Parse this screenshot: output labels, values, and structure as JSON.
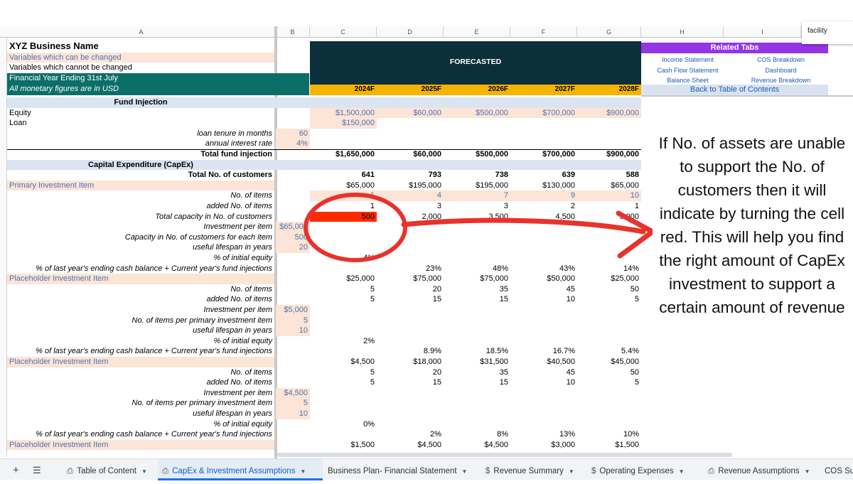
{
  "window": {
    "filter_box": "facility"
  },
  "col_headers": [
    "A",
    "B",
    "C",
    "D",
    "E",
    "F",
    "G",
    "H",
    "I"
  ],
  "header": {
    "business_name": "XYZ Business Name",
    "var_changed": "Variables which can be changed",
    "var_not_changed": "Variables which cannot be changed",
    "fy": "Financial Year Ending 31st July",
    "currency": "All monetary figures are in USD",
    "forecasted": "FORECASTED",
    "years": [
      "2024F",
      "2025F",
      "2026F",
      "2027F",
      "2028F"
    ]
  },
  "related_tabs": {
    "title": "Related Tabs",
    "links": [
      "Income Statement",
      "COS Breakdown",
      "Cash Flow Statement",
      "Dashboard",
      "Balance Sheet",
      "Revenue Breakdown"
    ],
    "back": "Back to Table of Contents"
  },
  "rows": [
    {
      "a": "Fund Injection",
      "type": "section"
    },
    {
      "a": "Equity",
      "al": "l",
      "c": [
        "$1,500,000",
        "$60,000",
        "$500,000",
        "$700,000",
        "$900,000"
      ],
      "cstyle": "input"
    },
    {
      "a": "Loan",
      "al": "l",
      "c": [
        "$150,000",
        "",
        "",
        "",
        ""
      ],
      "cstyle": "input1"
    },
    {
      "a": "loan tenure in months",
      "it": true,
      "b": "60"
    },
    {
      "a": "annual interest rate",
      "it": true,
      "b": "4%"
    },
    {
      "a": "Total fund injection",
      "bold": true,
      "c": [
        "$1,650,000",
        "$60,000",
        "$500,000",
        "$700,000",
        "$900,000"
      ],
      "border": true
    },
    {
      "a": "Capital Expenditure (CapEx)",
      "type": "section"
    },
    {
      "a": "Total No. of customers",
      "bold": true,
      "c": [
        "641",
        "793",
        "738",
        "639",
        "588"
      ]
    },
    {
      "a": "Primary Investment Item",
      "type": "item",
      "c": [
        "$65,000",
        "$195,000",
        "$195,000",
        "$130,000",
        "$65,000"
      ]
    },
    {
      "a": "No. of items",
      "it": true,
      "c": [
        "1",
        "4",
        "7",
        "9",
        "10"
      ],
      "cstyle": "input"
    },
    {
      "a": "added No. of items",
      "it": true,
      "c": [
        "1",
        "3",
        "3",
        "2",
        "1"
      ]
    },
    {
      "a": "Total capacity in No. of customers",
      "it": true,
      "c": [
        "500",
        "2,000",
        "3,500",
        "4,500",
        "5,000"
      ],
      "red": true
    },
    {
      "a": "Investment per item",
      "it": true,
      "b": "$65,000"
    },
    {
      "a": "Capacity in No. of customers for each item",
      "it": true,
      "b": "500"
    },
    {
      "a": "useful lifespan in years",
      "it": true,
      "b": "20"
    },
    {
      "a": "% of initial equity",
      "it": true,
      "c": [
        "4%",
        "",
        "",
        "",
        ""
      ]
    },
    {
      "a": "% of last year's ending cash balance + Current year's fund injections",
      "it": true,
      "c": [
        "",
        "23%",
        "48%",
        "43%",
        "14%"
      ]
    },
    {
      "a": "Placeholder Investment Item",
      "type": "item",
      "c": [
        "$25,000",
        "$75,000",
        "$75,000",
        "$50,000",
        "$25,000"
      ]
    },
    {
      "a": "No. of items",
      "it": true,
      "c": [
        "5",
        "20",
        "35",
        "45",
        "50"
      ]
    },
    {
      "a": "added No. of items",
      "it": true,
      "c": [
        "5",
        "15",
        "15",
        "10",
        "5"
      ]
    },
    {
      "a": "Investment per item",
      "it": true,
      "b": "$5,000"
    },
    {
      "a": "No. of items per primary investment item",
      "it": true,
      "b": "5"
    },
    {
      "a": "useful lifespan in years",
      "it": true,
      "b": "10"
    },
    {
      "a": "% of initial equity",
      "it": true,
      "c": [
        "2%",
        "",
        "",
        "",
        ""
      ]
    },
    {
      "a": "% of last year's ending cash balance + Current year's fund injections",
      "it": true,
      "c": [
        "",
        "8.9%",
        "18.5%",
        "16.7%",
        "5.4%"
      ]
    },
    {
      "a": "Placeholder Investment Item",
      "type": "item",
      "c": [
        "$4,500",
        "$18,000",
        "$31,500",
        "$40,500",
        "$45,000"
      ]
    },
    {
      "a": "No. of items",
      "it": true,
      "c": [
        "5",
        "20",
        "35",
        "45",
        "50"
      ]
    },
    {
      "a": "added No. of items",
      "it": true,
      "c": [
        "5",
        "15",
        "15",
        "10",
        "5"
      ]
    },
    {
      "a": "Investment per item",
      "it": true,
      "b": "$4,500"
    },
    {
      "a": "No. of items per primary investment item",
      "it": true,
      "b": "5"
    },
    {
      "a": "useful lifespan in years",
      "it": true,
      "b": "10"
    },
    {
      "a": "% of initial equity",
      "it": true,
      "c": [
        "0%",
        "",
        "",
        "",
        ""
      ]
    },
    {
      "a": "% of last year's ending cash balance + Current year's fund injections",
      "it": true,
      "c": [
        "",
        "2%",
        "8%",
        "13%",
        "10%"
      ]
    },
    {
      "a": "Placeholder Investment Item",
      "type": "item",
      "c": [
        "$1,500",
        "$4,500",
        "$4,500",
        "$3,000",
        "$1,500"
      ]
    }
  ],
  "annotation": "If No. of assets are unable to support the No. of customers then it will indicate by turning the cell red. This will help you find the right amount of CapEx investment to support a certain amount of revenue",
  "tabs": [
    "Table of Content",
    "CapEx & Investment Assumptions",
    "Business Plan- Financial Statement",
    "Revenue Summary",
    "Operating Expenses",
    "Revenue Assumptions",
    "COS Su"
  ],
  "colors": {
    "teal": "#0b6e69",
    "dark": "#0c2f3c",
    "gold": "#f4b400",
    "purple": "#9334e6",
    "input_bg": "#fce4d6",
    "red_cell": "#ff2a00",
    "annot_red": "#e8322b"
  }
}
